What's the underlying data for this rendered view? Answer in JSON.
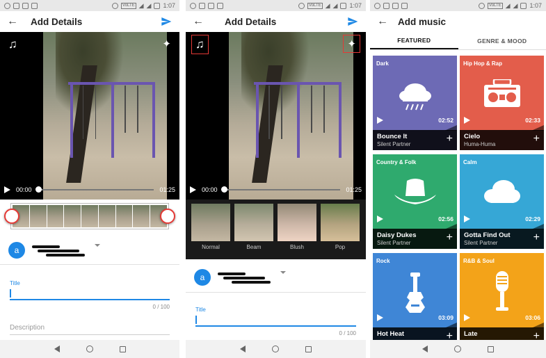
{
  "status": {
    "time": "1:07",
    "network": "VoLTE"
  },
  "screen1": {
    "title": "Add Details",
    "time_start": "00:00",
    "time_end": "01:25",
    "account_initial": "a",
    "title_label": "Title",
    "title_counter": "0 / 100",
    "description_placeholder": "Description"
  },
  "screen2": {
    "title": "Add Details",
    "time_start": "00:00",
    "time_end": "01:25",
    "filters": [
      "Normal",
      "Beam",
      "Blush",
      "Pop"
    ],
    "account_initial": "a",
    "title_label": "Title",
    "title_counter": "0 / 100"
  },
  "screen3": {
    "title": "Add music",
    "tabs": [
      "FEATURED",
      "GENRE & MOOD"
    ],
    "active_tab": "FEATURED",
    "tracks": [
      {
        "genre": "Dark",
        "song": "Bounce It",
        "artist": "Silent Partner",
        "duration": "02:52",
        "color": "#6d6ab5",
        "icon": "cloud-rain-icon"
      },
      {
        "genre": "Hip Hop & Rap",
        "song": "Cielo",
        "artist": "Huma-Huma",
        "duration": "02:33",
        "color": "#e35d4b",
        "icon": "boombox-icon"
      },
      {
        "genre": "Country & Folk",
        "song": "Daisy Dukes",
        "artist": "Silent Partner",
        "duration": "02:56",
        "color": "#2faa6e",
        "icon": "cowboy-hat-icon"
      },
      {
        "genre": "Calm",
        "song": "Gotta Find Out",
        "artist": "Silent Partner",
        "duration": "02:29",
        "color": "#36a7d6",
        "icon": "cloud-icon"
      },
      {
        "genre": "Rock",
        "song": "Hot Heat",
        "artist": "",
        "duration": "03:09",
        "color": "#3f86d6",
        "icon": "guitar-icon"
      },
      {
        "genre": "R&B & Soul",
        "song": "Late",
        "artist": "",
        "duration": "03:06",
        "color": "#f3a319",
        "icon": "microphone-icon"
      }
    ]
  },
  "colors": {
    "accent": "#1e88e5",
    "highlight": "#e53935"
  }
}
